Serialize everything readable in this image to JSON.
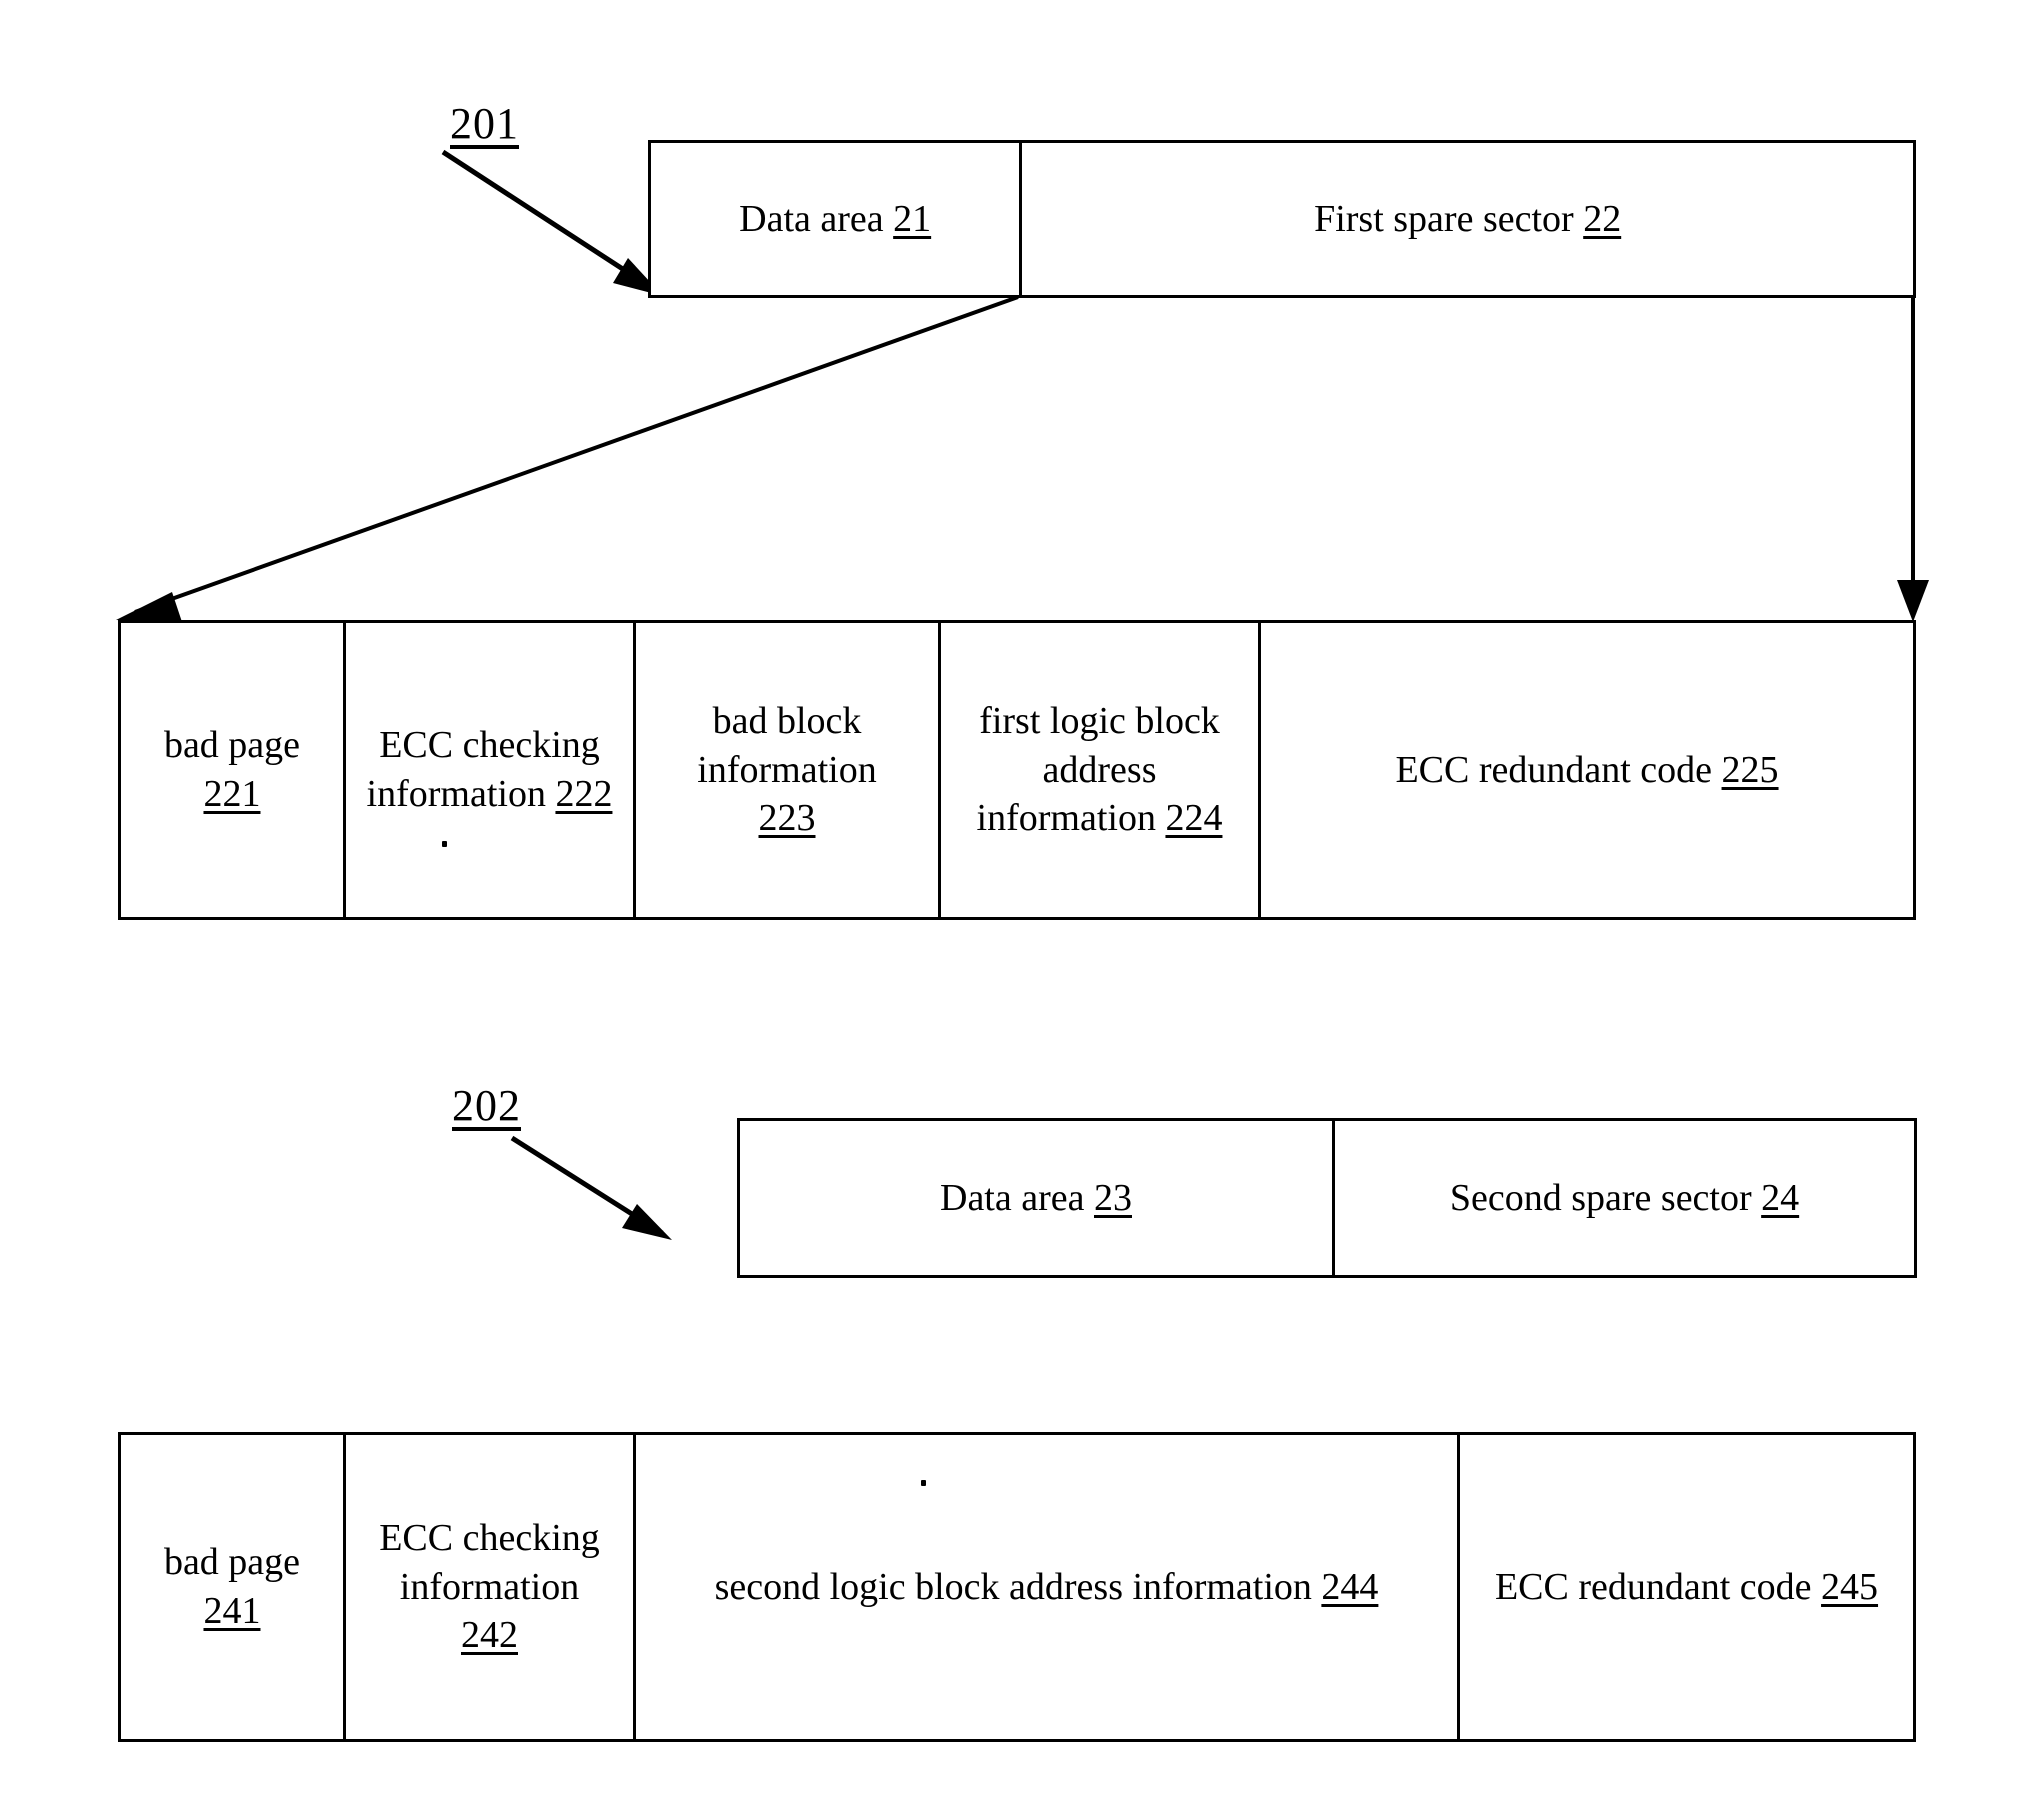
{
  "figure": {
    "labels": [
      {
        "id": "label-201",
        "text": "201"
      },
      {
        "id": "label-202",
        "text": "202"
      }
    ]
  },
  "rows": {
    "first_sector_overview": {
      "name": "first-sector-overview",
      "cells": [
        {
          "text": "Data area ",
          "ref": "21"
        },
        {
          "text": "First spare sector ",
          "ref": "22"
        }
      ]
    },
    "first_spare_sector_detail": {
      "name": "first-spare-sector-detail",
      "cells": [
        {
          "text": "bad page",
          "ref": "221"
        },
        {
          "text": "ECC checking information ",
          "ref": "222"
        },
        {
          "text": "bad block information",
          "ref": "223"
        },
        {
          "text": "first logic block address information ",
          "ref": "224"
        },
        {
          "text": "ECC redundant code ",
          "ref": "225"
        }
      ]
    },
    "second_sector_overview": {
      "name": "second-sector-overview",
      "cells": [
        {
          "text": "Data area ",
          "ref": "23"
        },
        {
          "text": "Second spare sector ",
          "ref": "24"
        }
      ]
    },
    "second_spare_sector_detail": {
      "name": "second-spare-sector-detail",
      "cells": [
        {
          "text": "bad page",
          "ref": "241"
        },
        {
          "text": "ECC checking information",
          "ref": "242"
        },
        {
          "text": "second logic block address information ",
          "ref": "244"
        },
        {
          "text": "ECC redundant code ",
          "ref": "245"
        }
      ]
    }
  },
  "colors": {
    "ink": "#000000",
    "paper": "#ffffff"
  }
}
